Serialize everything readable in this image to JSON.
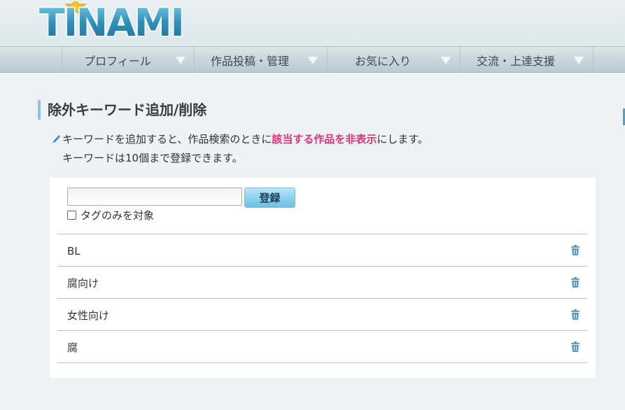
{
  "header": {
    "logo_text": "TINAMI",
    "logo_colors": {
      "fill": "#2f8fb8",
      "outline": "#ffffff",
      "star": "#f6c81a"
    }
  },
  "nav": {
    "items": [
      {
        "label": "プロフィール"
      },
      {
        "label": "作品投稿・管理"
      },
      {
        "label": "お気に入り"
      },
      {
        "label": "交流・上達支援"
      }
    ],
    "arrow_icon": "triangle-down-icon"
  },
  "page": {
    "title": "除外キーワード追加/削除",
    "desc_line1_pre": "キーワードを追加すると、作品検索のときに",
    "desc_line1_emph": "該当する作品を非表示",
    "desc_line1_post": "にします。",
    "desc_line2": "キーワードは10個まで登録できます。",
    "pencil_icon": "pencil-icon",
    "emphasis_color": "#d6337a",
    "accent_color": "#8cc4dd"
  },
  "form": {
    "keyword_value": "",
    "register_label": "登録",
    "tag_only_label": "タグのみを対象",
    "tag_only_checked": false
  },
  "keywords": [
    {
      "word": "BL"
    },
    {
      "word": "腐向け"
    },
    {
      "word": "女性向け"
    },
    {
      "word": "腐"
    }
  ],
  "delete_icon": "trash-icon"
}
